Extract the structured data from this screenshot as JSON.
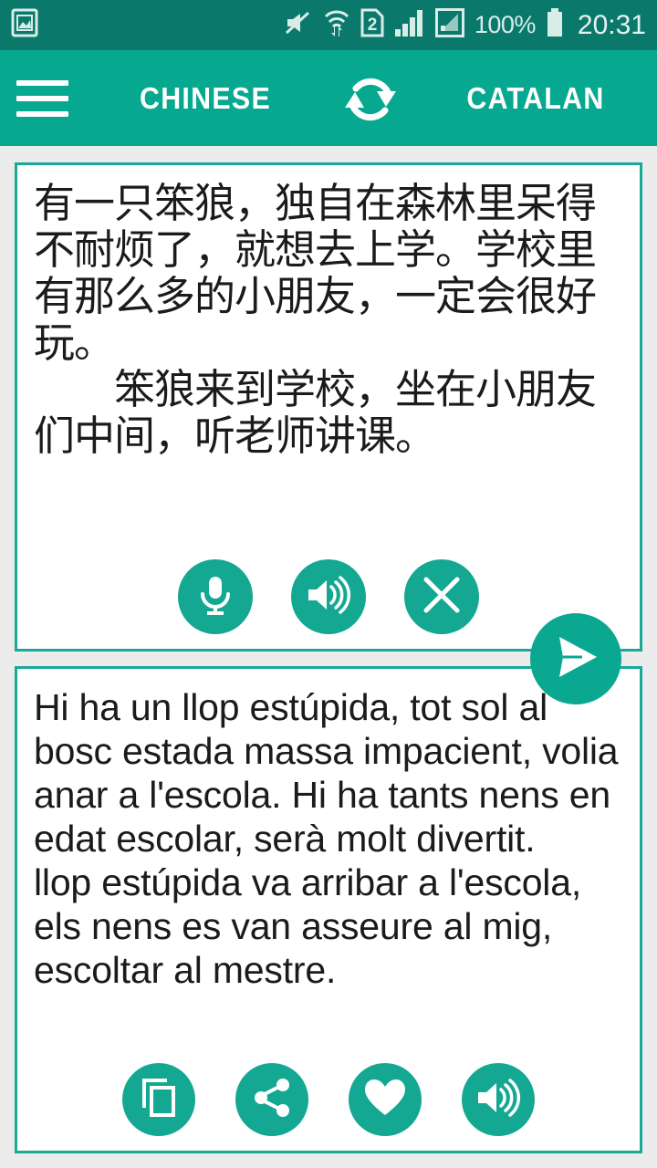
{
  "status_bar": {
    "notification_icon": "image-icon",
    "icons": [
      "mute-icon",
      "wifi-transfer-icon",
      "sim2-icon",
      "signal-bars-icon",
      "signal-boxed-icon"
    ],
    "battery_percent": "100%",
    "battery_icon": "battery-full-icon",
    "clock": "20:31",
    "background_color": "#0a796c",
    "foreground_color": "#d9ece8"
  },
  "app_bar": {
    "menu_icon": "hamburger-menu-icon",
    "source_language": "CHINESE",
    "swap_icon": "swap-languages-icon",
    "target_language": "CATALAN",
    "background_color": "#06a98f",
    "text_color": "#ffffff"
  },
  "source_card": {
    "text": "有一只笨狼，独自在森林里呆得不耐烦了，就想去上学。学校里有那么多的小朋友，一定会很好玩。\n　　笨狼来到学校，坐在小朋友们中间，听老师讲课。",
    "actions": [
      {
        "name": "microphone",
        "icon": "microphone-icon"
      },
      {
        "name": "speak",
        "icon": "speaker-icon"
      },
      {
        "name": "clear",
        "icon": "close-x-icon"
      }
    ]
  },
  "send_button": {
    "icon": "send-paper-plane-icon",
    "color": "#0aa891"
  },
  "target_card": {
    "text": "Hi ha un llop estúpida, tot sol al bosc estada massa impacient, volia anar a l'escola. Hi ha tants nens en edat escolar, serà molt divertit.\nllop estúpida va arribar a l'escola, els nens es van asseure al mig, escoltar al mestre.",
    "actions": [
      {
        "name": "copy",
        "icon": "copy-icon"
      },
      {
        "name": "share",
        "icon": "share-icon"
      },
      {
        "name": "favorite",
        "icon": "heart-icon"
      },
      {
        "name": "speak",
        "icon": "speaker-icon"
      }
    ]
  },
  "theme": {
    "accent": "#14a892",
    "card_border": "#1aa897",
    "page_background": "#ececec",
    "text_color": "#1b1b1b"
  }
}
